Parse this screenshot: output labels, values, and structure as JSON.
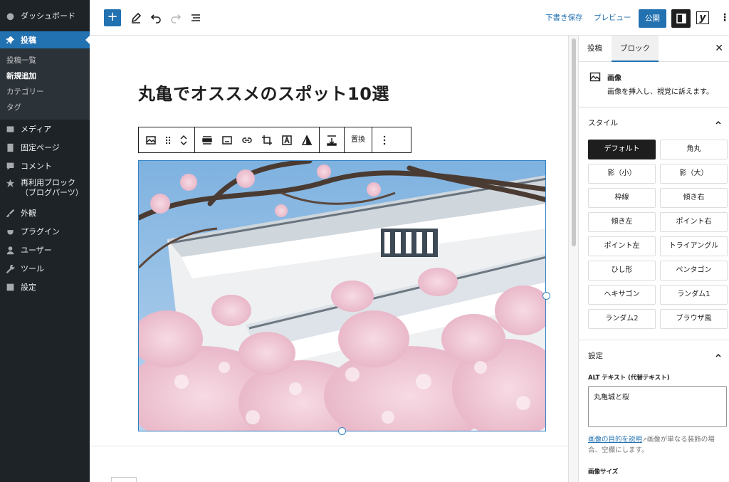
{
  "admin_menu": {
    "dashboard": "ダッシュボード",
    "posts": "投稿",
    "posts_sub": [
      "投稿一覧",
      "新規追加",
      "カテゴリー",
      "タグ"
    ],
    "media": "メディア",
    "pages": "固定ページ",
    "comments": "コメント",
    "reusable_blocks": "再利用ブロック（ブログパーツ）",
    "appearance": "外観",
    "plugins": "プラグイン",
    "users": "ユーザー",
    "tools": "ツール",
    "settings": "設定"
  },
  "topbar": {
    "add_label": "+",
    "save_draft": "下書き保存",
    "preview": "プレビュー",
    "publish": "公開",
    "yoast": "y",
    "more": "⋮"
  },
  "editor": {
    "post_title": "丸亀でオススメのスポット10選",
    "replace_label": "置換"
  },
  "sidebar": {
    "tab_post": "投稿",
    "tab_block": "ブロック",
    "close": "✕",
    "block_title": "画像",
    "block_desc": "画像を挿入し、視覚に訴えます。",
    "styles_heading": "スタイル",
    "styles": [
      "デフォルト",
      "角丸",
      "影（小）",
      "影（大）",
      "枠線",
      "傾き右",
      "傾き左",
      "ポイント右",
      "ポイント左",
      "トライアングル",
      "ひし形",
      "ペンタゴン",
      "ヘキサゴン",
      "ランダム1",
      "ランダム2",
      "ブラウザ風"
    ],
    "settings_heading": "設定",
    "alt_label": "ALT テキスト (代替テキスト)",
    "alt_value": "丸亀城と桜",
    "alt_help_link": "画像の目的を説明",
    "alt_help_text": "画像が単なる装飾の場合、空欄にします。",
    "image_size_label": "画像サイズ"
  },
  "colors": {
    "admin_bg": "#1d2327",
    "accent": "#2271b1",
    "selection": "#3582c4"
  }
}
